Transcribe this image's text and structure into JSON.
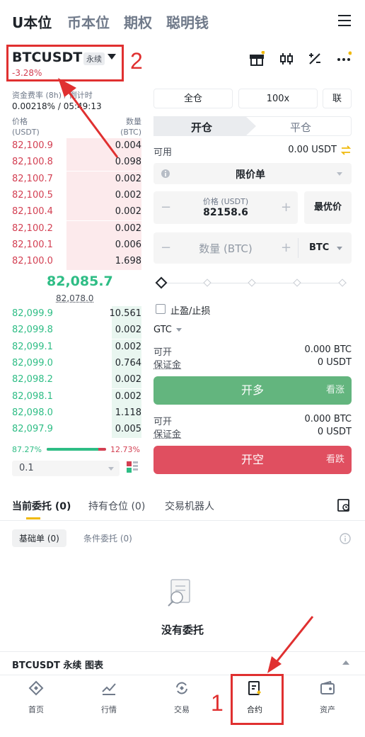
{
  "top_tabs": [
    "U本位",
    "币本位",
    "期权",
    "聪明钱"
  ],
  "symbol": {
    "name": "BTCUSDT",
    "type": "永续",
    "change": "-3.28%"
  },
  "funding": {
    "label": "资金费率 (8h) / 倒计时",
    "value": "0.00218% / 05:49:13"
  },
  "orderbook": {
    "price_header": "价格",
    "price_unit": "(USDT)",
    "qty_header": "数量",
    "qty_unit": "(BTC)",
    "asks": [
      {
        "price": "82,100.9",
        "qty": "0.004",
        "depth": 0.58
      },
      {
        "price": "82,100.8",
        "qty": "0.098",
        "depth": 0.58
      },
      {
        "price": "82,100.7",
        "qty": "0.002",
        "depth": 0.58
      },
      {
        "price": "82,100.5",
        "qty": "0.002",
        "depth": 0.58
      },
      {
        "price": "82,100.4",
        "qty": "0.002",
        "depth": 0.58
      },
      {
        "price": "82,100.2",
        "qty": "0.002",
        "depth": 0.58
      },
      {
        "price": "82,100.1",
        "qty": "0.006",
        "depth": 0.58
      },
      {
        "price": "82,100.0",
        "qty": "1.698",
        "depth": 0.58
      }
    ],
    "last_price": "82,085.7",
    "mark_price": "82,078.0",
    "bids": [
      {
        "price": "82,099.9",
        "qty": "10.561",
        "depth": 0.23
      },
      {
        "price": "82,099.8",
        "qty": "0.002",
        "depth": 0.23
      },
      {
        "price": "82,099.1",
        "qty": "0.002",
        "depth": 0.23
      },
      {
        "price": "82,099.0",
        "qty": "0.764",
        "depth": 0.23
      },
      {
        "price": "82,098.2",
        "qty": "0.002",
        "depth": 0.23
      },
      {
        "price": "82,098.1",
        "qty": "0.002",
        "depth": 0.23
      },
      {
        "price": "82,098.0",
        "qty": "1.118",
        "depth": 0.23
      },
      {
        "price": "82,097.9",
        "qty": "0.005",
        "depth": 0.23
      }
    ],
    "buy_ratio": "87.27%",
    "sell_ratio": "12.73%",
    "buy_ratio_value": 0.8727,
    "depth_step": "0.1"
  },
  "form": {
    "margin_mode": "全仓",
    "leverage": "100x",
    "asset_mode": "联",
    "open_tab": "开仓",
    "close_tab": "平仓",
    "available_label": "可用",
    "available_value": "0.00 USDT",
    "order_type": "限价单",
    "price_label": "价格 (USDT)",
    "price_value": "82158.6",
    "best_price": "最优价",
    "qty_placeholder": "数量 (BTC)",
    "qty_unit": "BTC",
    "tpsl": "止盈/止损",
    "tif": "GTC",
    "long": {
      "open_label": "可开",
      "open_value": "0.000 BTC",
      "margin_label": "保证金",
      "margin_value": "0 USDT",
      "button": "开多",
      "hint": "看涨"
    },
    "short": {
      "open_label": "可开",
      "open_value": "0.000 BTC",
      "margin_label": "保证金",
      "margin_value": "0 USDT",
      "button": "开空",
      "hint": "看跌"
    }
  },
  "bottom_tabs": [
    "当前委托 (0)",
    "持有仓位 (0)",
    "交易机器人"
  ],
  "sub_tabs": [
    "基础单 (0)",
    "条件委托 (0)"
  ],
  "empty_text": "没有委托",
  "chart_bar": "BTCUSDT 永续 图表",
  "nav": [
    "首页",
    "行情",
    "交易",
    "合约",
    "资产"
  ],
  "annotations": [
    "1",
    "2"
  ],
  "colors": {
    "up": "#2ebd85",
    "down": "#d33f52",
    "accent": "#f0b90b",
    "annotation": "#e03030"
  }
}
